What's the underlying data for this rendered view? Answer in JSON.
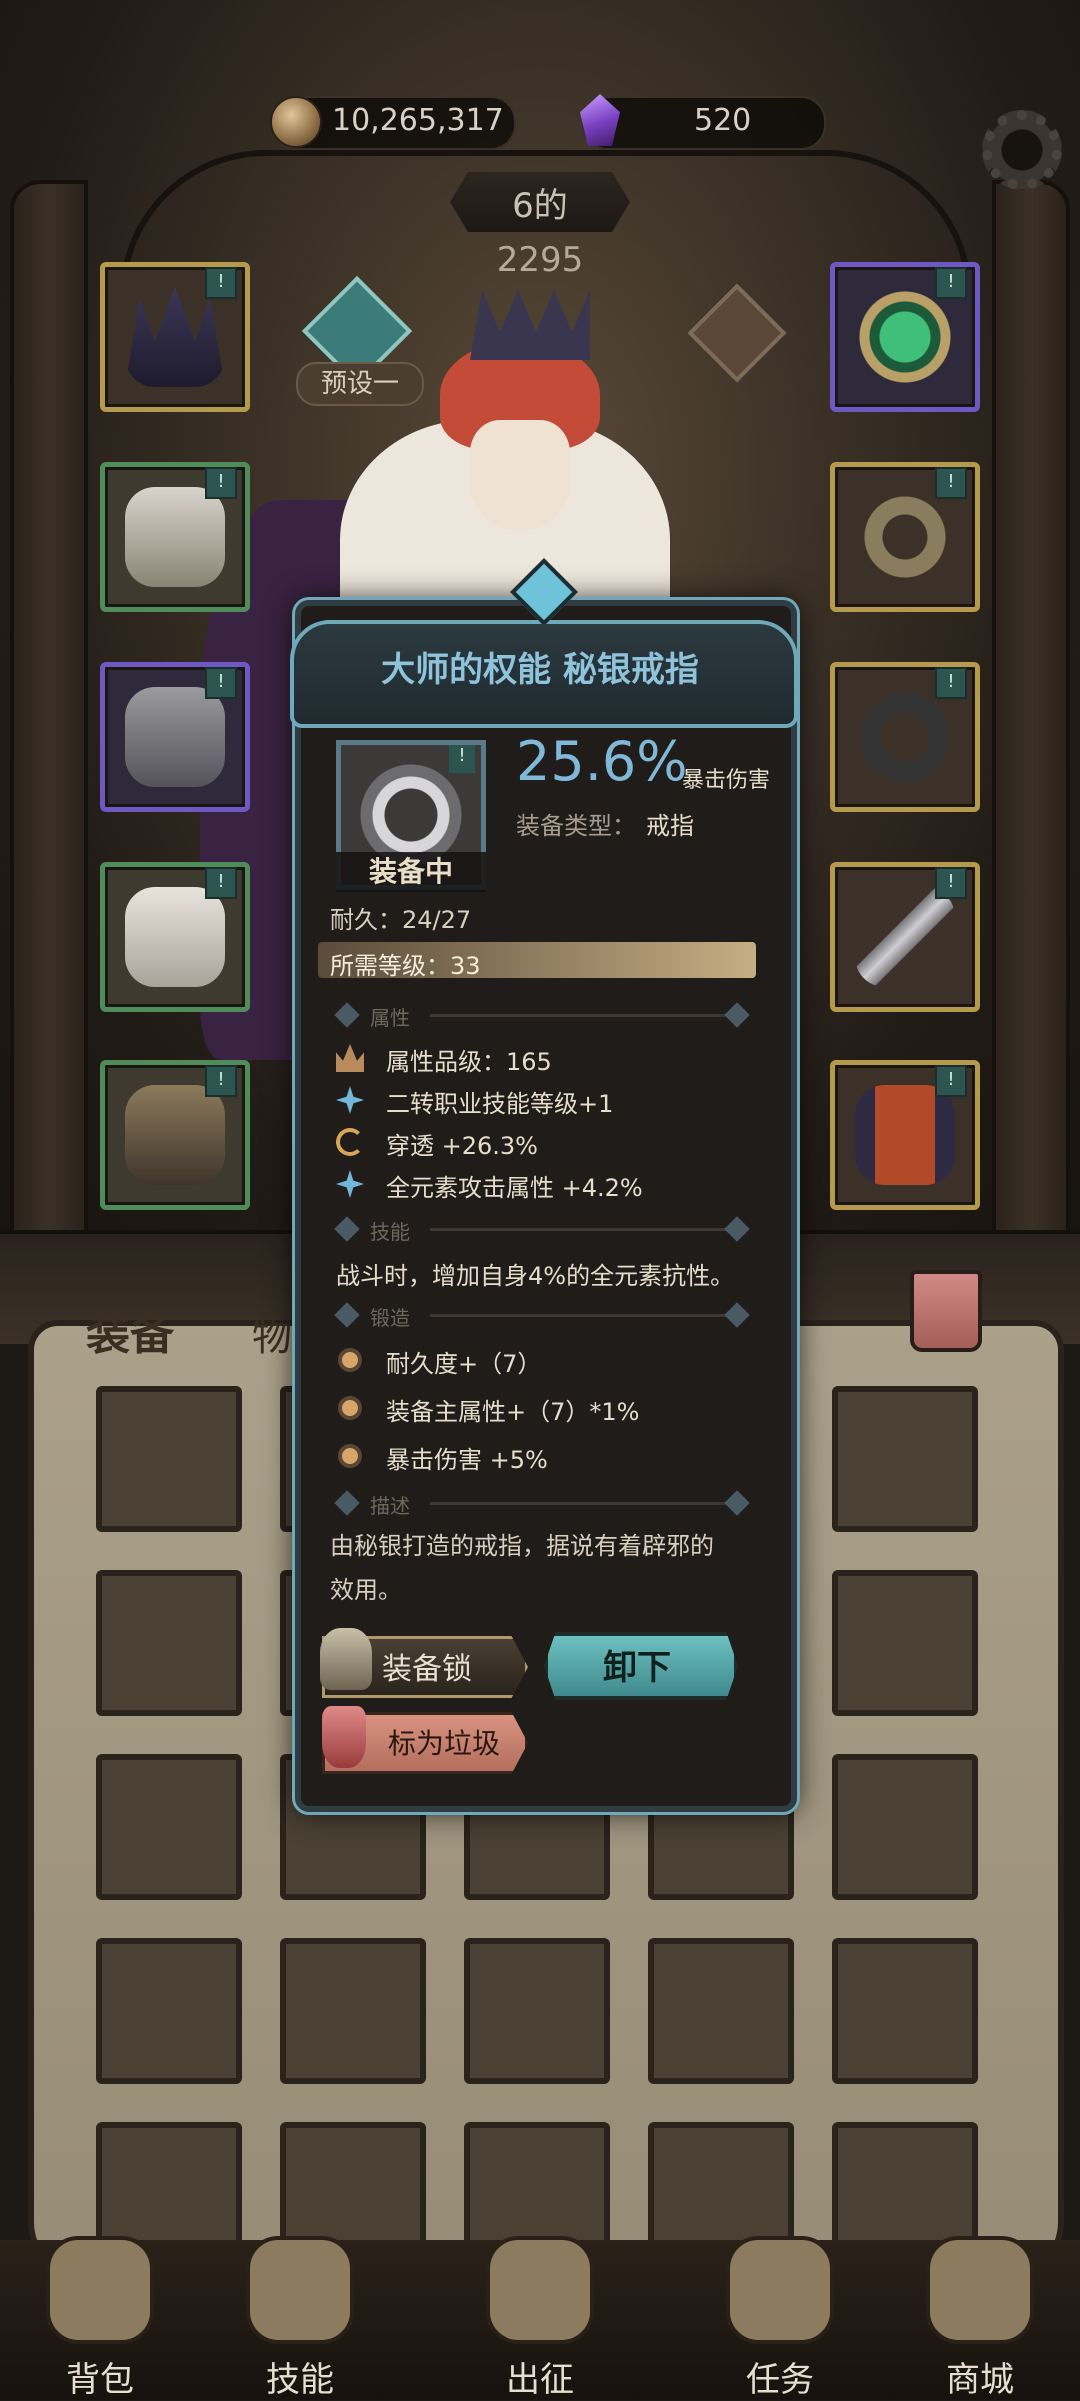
{
  "currency": {
    "gold": "10,265,317",
    "gems": "520"
  },
  "header": {
    "character_name": "6的",
    "power": "2295",
    "preset_label": "预设一"
  },
  "equipment_slots": {
    "left": [
      {
        "name": "helmet",
        "rarity": "gold"
      },
      {
        "name": "chest",
        "rarity": "green"
      },
      {
        "name": "gloves",
        "rarity": "purple"
      },
      {
        "name": "pants",
        "rarity": "green"
      },
      {
        "name": "boots",
        "rarity": "green"
      }
    ],
    "right": [
      {
        "name": "amulet",
        "rarity": "purple"
      },
      {
        "name": "ring-1",
        "rarity": "gold"
      },
      {
        "name": "ring-2",
        "rarity": "gold"
      },
      {
        "name": "weapon",
        "rarity": "gold"
      },
      {
        "name": "banner",
        "rarity": "gold"
      }
    ],
    "flag_glyph": "!"
  },
  "tabs": {
    "equipment": "装备",
    "items": "物品"
  },
  "popup": {
    "title": "大师的权能 秘银戒指",
    "equipped_label": "装备中",
    "main_stat_value": "25.6%",
    "main_stat_label": "暴击伤害",
    "equip_type_label": "装备类型：",
    "equip_type_value": "戒指",
    "durability": "耐久：24/27",
    "required_level": "所需等级：33",
    "sections": {
      "attributes": "属性",
      "skill": "技能",
      "forge": "锻造",
      "description": "描述"
    },
    "attributes": [
      {
        "text": "属性品级：165",
        "icon": "crown-icon"
      },
      {
        "text": "二转职业技能等级+1",
        "icon": "star-icon"
      },
      {
        "text": "穿透 +26.3%",
        "icon": "swirl-icon"
      },
      {
        "text": "全元素攻击属性 +4.2%",
        "icon": "star-icon"
      }
    ],
    "skill_text": "战斗时，增加自身4%的全元素抗性。",
    "forge": [
      {
        "text": "耐久度+（7）"
      },
      {
        "text": "装备主属性+（7）*1%"
      },
      {
        "text": "暴击伤害 +5%"
      }
    ],
    "description_lines": [
      "由秘银打造的戒指，据说有着辟邪的",
      "效用。"
    ],
    "buttons": {
      "lock": "装备锁",
      "unequip": "卸下",
      "mark_junk": "标为垃圾"
    }
  },
  "bottom_nav": [
    {
      "label": "背包",
      "icon": "backpack-icon"
    },
    {
      "label": "技能",
      "icon": "skill-book-icon"
    },
    {
      "label": "出征",
      "icon": "battle-icon"
    },
    {
      "label": "任务",
      "icon": "quest-icon"
    },
    {
      "label": "商城",
      "icon": "shop-icon"
    }
  ],
  "colors": {
    "accent": "#6fa8b8",
    "main_stat": "#7fb8d8",
    "unequip_button": "#5fb3b4",
    "junk_button": "#c98070"
  }
}
